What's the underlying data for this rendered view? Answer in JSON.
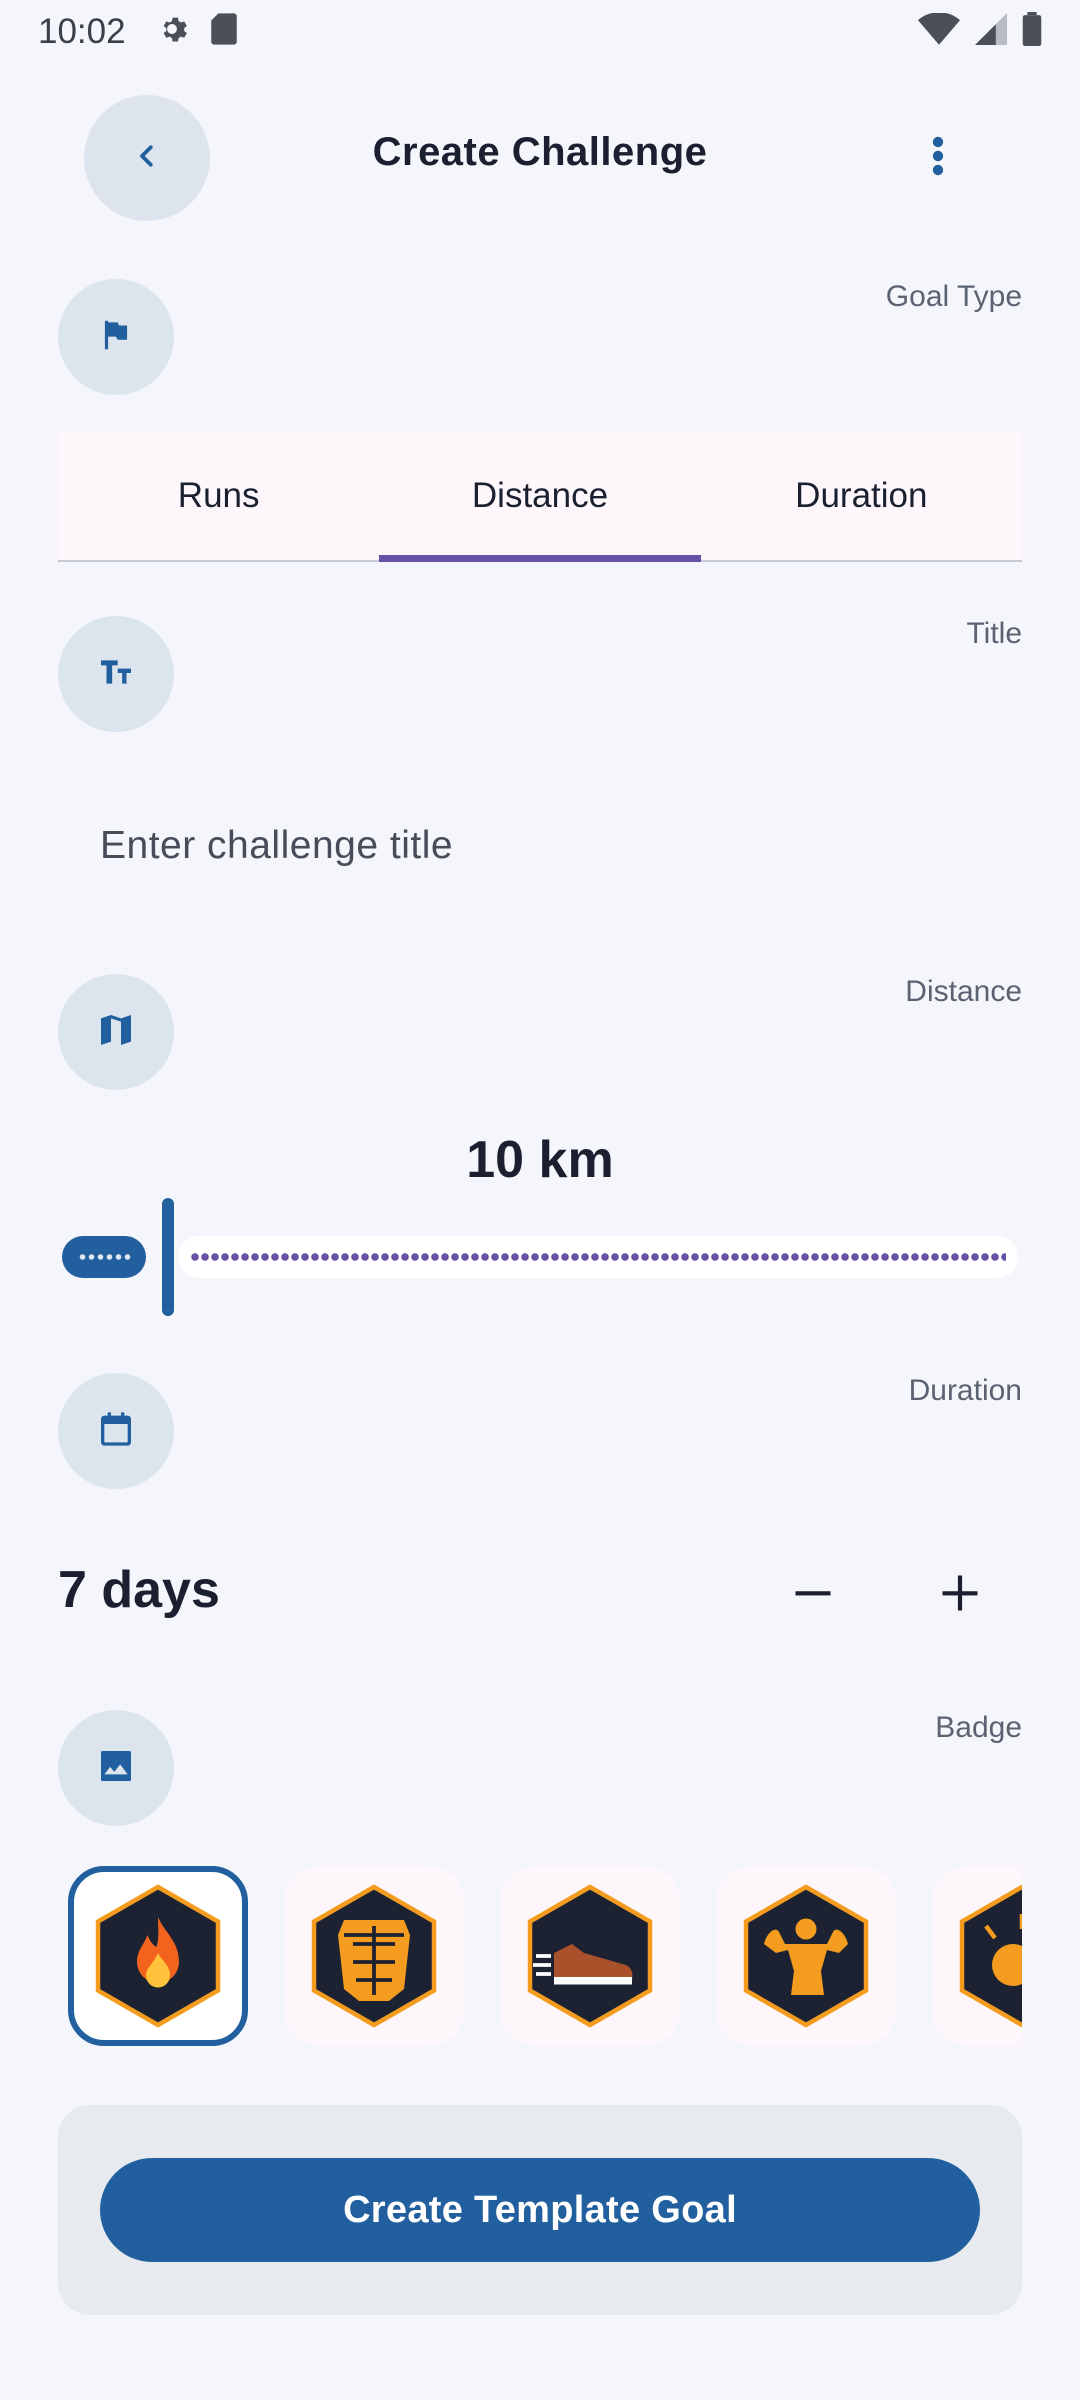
{
  "status_bar": {
    "time": "10:02",
    "icons": [
      "settings-icon",
      "sd-card-icon",
      "wifi-icon",
      "cell-signal-icon",
      "battery-icon"
    ]
  },
  "header": {
    "title": "Create Challenge",
    "back_icon": "chevron-left-icon",
    "more_icon": "more-vertical-icon"
  },
  "goal_type": {
    "label": "Goal Type",
    "icon": "flag-icon",
    "tabs": [
      {
        "label": "Runs",
        "active": false
      },
      {
        "label": "Distance",
        "active": true
      },
      {
        "label": "Duration",
        "active": false
      }
    ]
  },
  "title_section": {
    "label": "Title",
    "icon": "text-size-icon",
    "placeholder": "Enter challenge title",
    "value": ""
  },
  "distance_section": {
    "label": "Distance",
    "icon": "map-icon",
    "value_text": "10 km"
  },
  "duration_section": {
    "label": "Duration",
    "icon": "calendar-icon",
    "value_text": "7 days",
    "decrement_icon": "minus-icon",
    "increment_icon": "plus-icon"
  },
  "badge_section": {
    "label": "Badge",
    "icon": "image-icon",
    "badges": [
      {
        "name": "fire-badge",
        "selected": true
      },
      {
        "name": "abs-badge",
        "selected": false
      },
      {
        "name": "running-shoe-badge",
        "selected": false
      },
      {
        "name": "muscle-badge",
        "selected": false
      },
      {
        "name": "explosion-badge",
        "selected": false
      }
    ]
  },
  "actions": {
    "primary_label": "Create Template Goal"
  },
  "colors": {
    "primary": "#225f9e",
    "tab_indicator": "#6651a4",
    "background": "#f4f6fb",
    "badge_gold": "#f39c1f",
    "badge_dark": "#1c2231"
  }
}
